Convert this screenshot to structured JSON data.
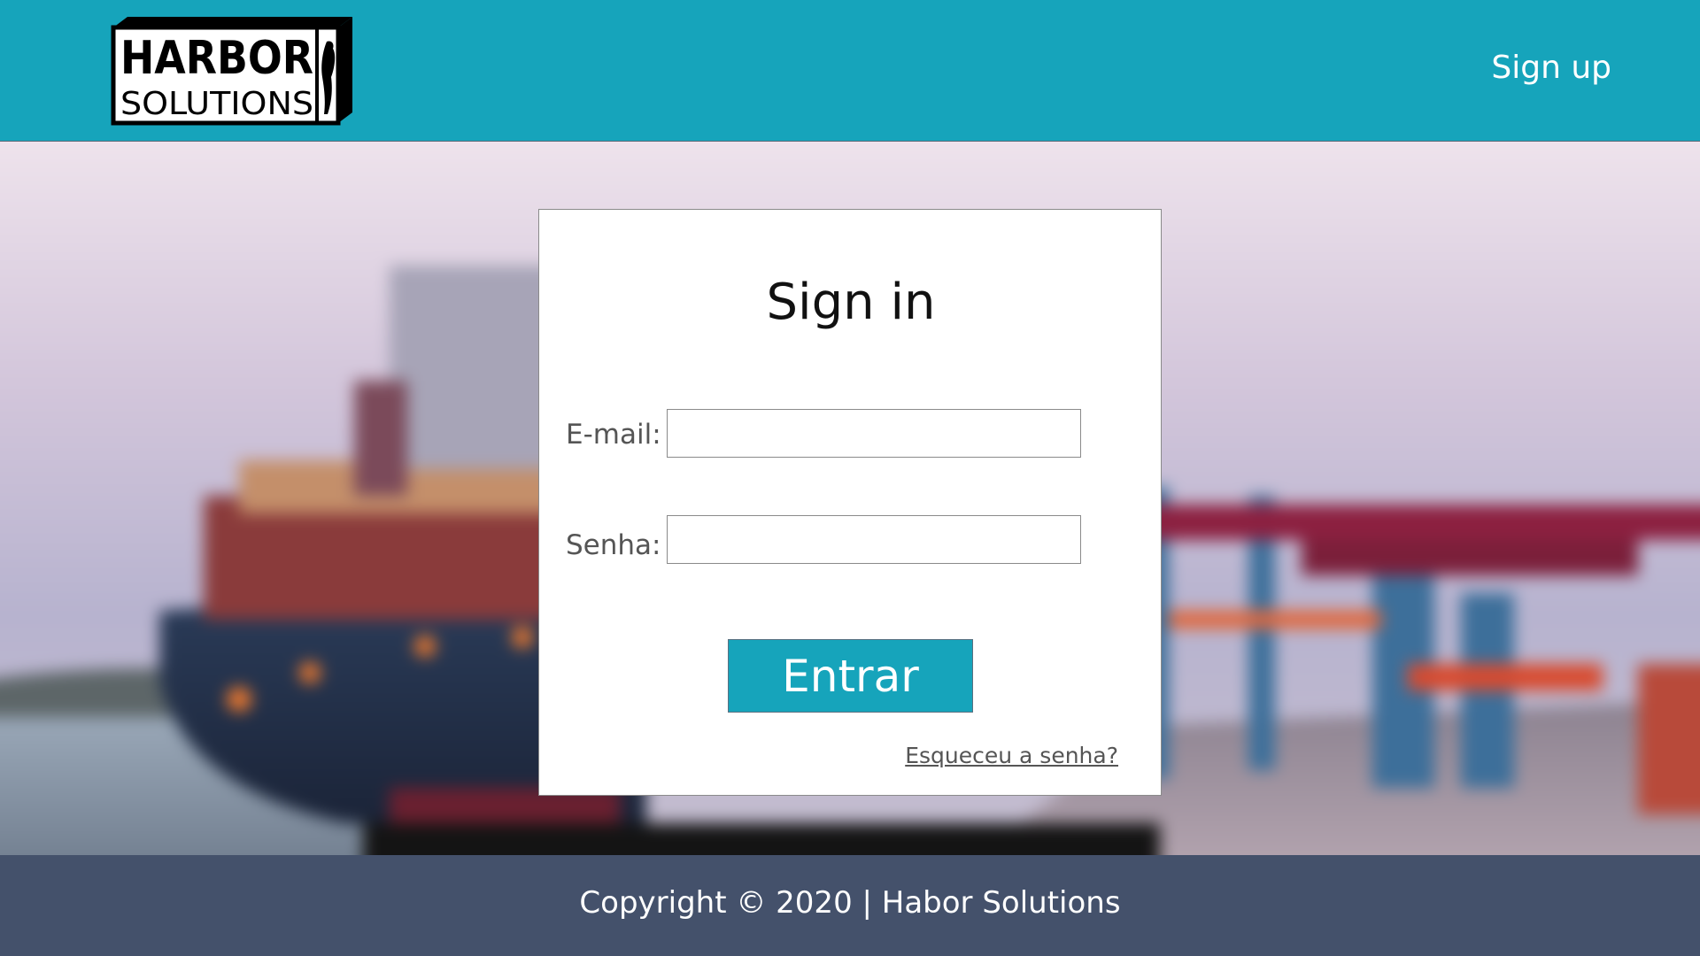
{
  "header": {
    "logo_text_line1": "HARBOR",
    "logo_text_line2": "SOLUTIONS",
    "signup_label": "Sign up"
  },
  "login": {
    "title": "Sign in",
    "email_label": "E-mail:",
    "email_value": "",
    "password_label": "Senha:",
    "password_value": "",
    "submit_label": "Entrar",
    "forgot_label": "Esqueceu a senha?"
  },
  "footer": {
    "copyright": "Copyright © 2020 | Habor Solutions"
  },
  "colors": {
    "brand_teal": "#16a4bb",
    "footer_navy": "#44516b",
    "card_bg": "#ffffff"
  }
}
